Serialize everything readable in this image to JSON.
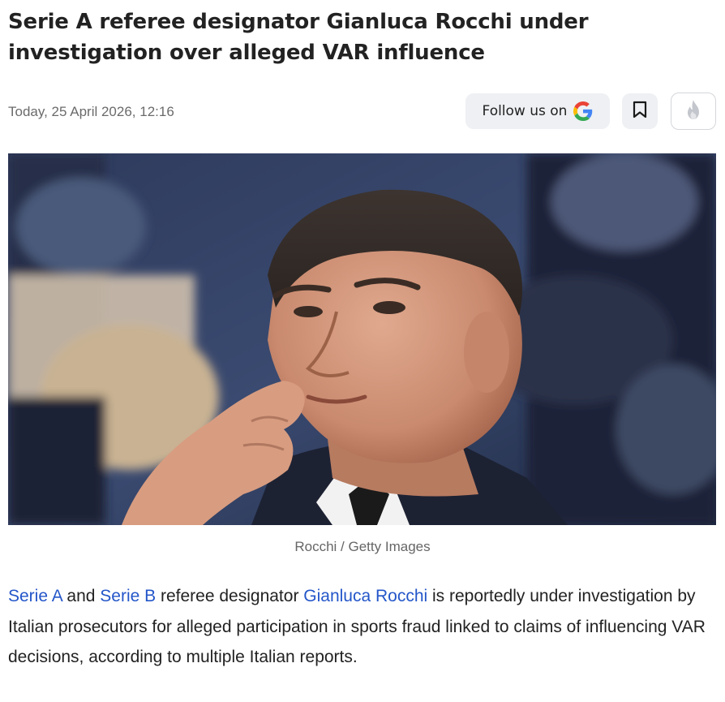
{
  "article": {
    "title": "Serie A referee designator Gianluca Rocchi under investigation over alleged VAR influence",
    "timestamp": "Today, 25 April 2026, 12:16",
    "follow_label": "Follow us on",
    "image_caption": "Rocchi / Getty Images",
    "body": {
      "link1": "Serie A",
      "text1": " and ",
      "link2": "Serie B",
      "text2": " referee designator ",
      "link3": "Gianluca Rocchi",
      "text3": " is reportedly under investigation by Italian prosecutors for alleged participation in sports fraud linked to claims of influencing VAR decisions, according to multiple Italian reports."
    }
  },
  "icons": {
    "follow": "google-g-icon",
    "bookmark": "bookmark-icon",
    "fire": "flame-icon"
  },
  "colors": {
    "link": "#2456c9",
    "button_bg": "#eef0f3",
    "meta_text": "#6b6b6b"
  }
}
